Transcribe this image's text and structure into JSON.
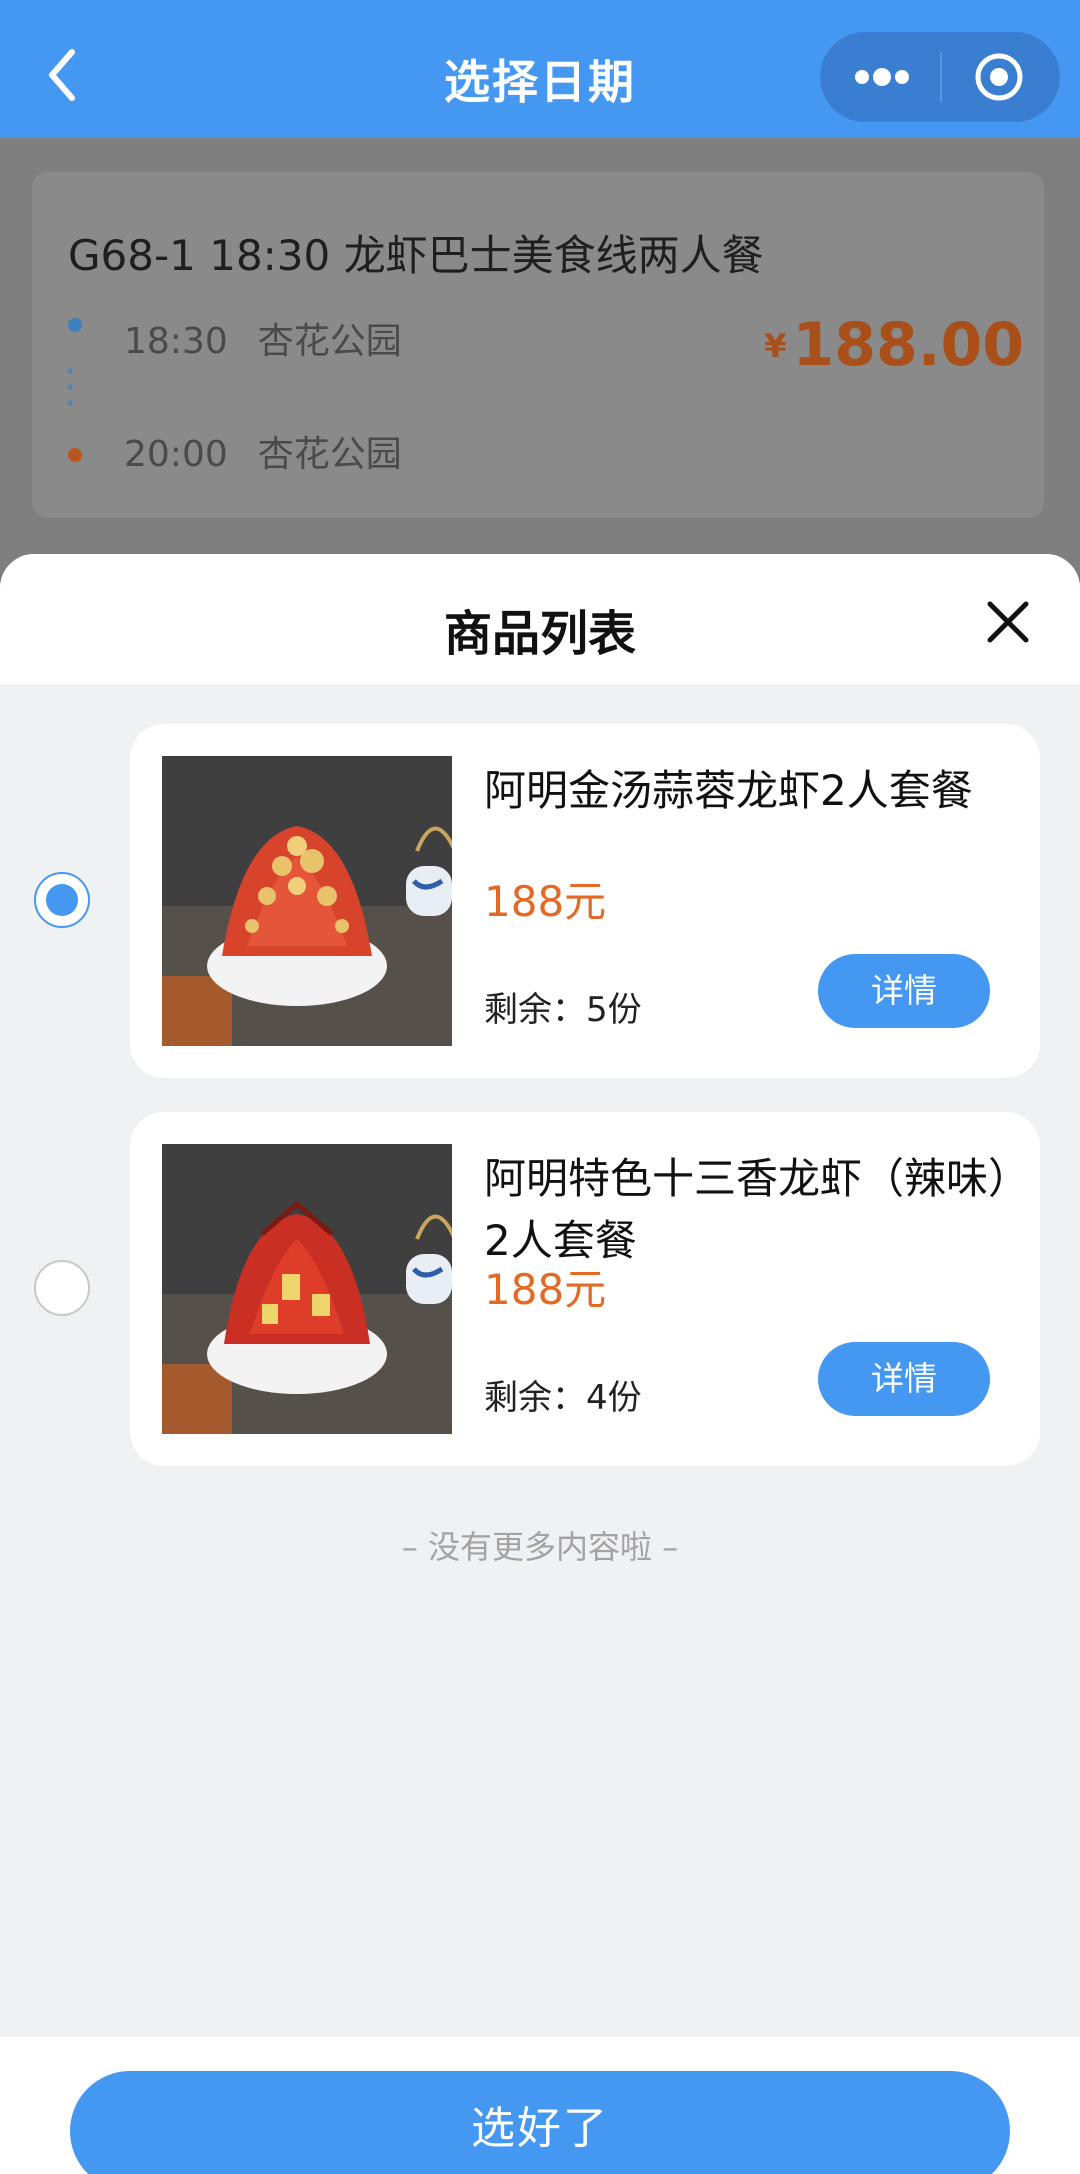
{
  "navbar": {
    "title": "选择日期",
    "back_icon": "chevron-left-icon",
    "more_icon": "more-dots-icon",
    "target_icon": "target-icon",
    "color": "#4598f2"
  },
  "route_card": {
    "name": "G68-1 18:30 龙虾巴士美食线两人餐",
    "stops": [
      {
        "time": "18:30",
        "place": "杏花公园",
        "dot_color": "#3d7fc0"
      },
      {
        "time": "20:00",
        "place": "杏花公园",
        "dot_color": "#b8561e"
      }
    ],
    "price_symbol": "¥",
    "price": "188.00"
  },
  "sheet": {
    "title": "商品列表",
    "close_icon": "close-icon",
    "items": [
      {
        "name": "阿明金汤蒜蓉龙虾2人套餐",
        "price": "188元",
        "stock": "剩余：5份",
        "detail_label": "详情",
        "selected": true,
        "image_icon": "crawfish-garlic-dish-image"
      },
      {
        "name": "阿明特色十三香龙虾（辣味）2人套餐",
        "price": "188元",
        "stock": "剩余：4份",
        "detail_label": "详情",
        "selected": false,
        "image_icon": "crawfish-spicy-dish-image"
      }
    ],
    "end_text": "– 没有更多内容啦 –"
  },
  "footer": {
    "confirm_label": "选好了"
  },
  "colors": {
    "accent": "#4598f2",
    "price": "#e26a25"
  }
}
